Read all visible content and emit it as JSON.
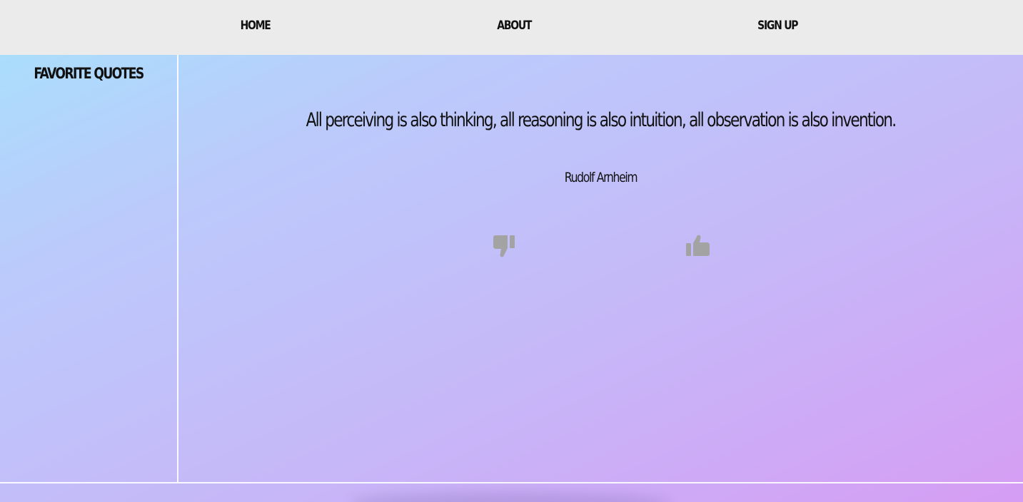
{
  "nav": {
    "items": [
      {
        "label": "HOME"
      },
      {
        "label": "ABOUT"
      },
      {
        "label": "SIGN UP"
      }
    ]
  },
  "sidebar": {
    "title": "FAVORITE QUOTES"
  },
  "quote": {
    "text": "All perceiving is also thinking, all reasoning is also intuition, all observation is also invention.",
    "author": "Rudolf Arnheim"
  },
  "votes": {
    "dislike_icon": "thumbs-down-icon",
    "like_icon": "thumbs-up-icon",
    "icon_color": "#a3a3a3"
  },
  "colors": {
    "nav_bg": "#ebebeb",
    "gradient_start": "#a7e2fc",
    "gradient_mid": "#c6b8f8",
    "gradient_end": "#d59df4",
    "text": "#111111"
  }
}
